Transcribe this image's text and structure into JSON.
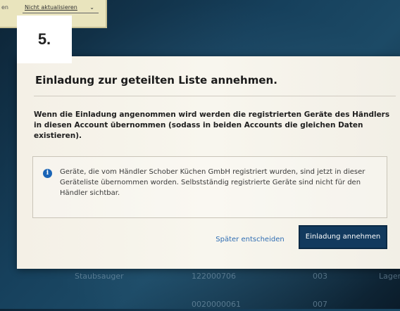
{
  "step_label": "5.",
  "toolbar": {
    "edge_text": "en",
    "dropdown_label": "Nicht aktualisieren",
    "dropdown_icon": "chevron-down-icon"
  },
  "dialog": {
    "title": "Einladung zur geteilten Liste annehmen.",
    "body": "Wenn die Einladung angenommen wird werden die registrierten Geräte des Händlers in diesen Account übernommen (sodass in beiden Accounts die gleichen Daten existieren).",
    "info_icon": "info-icon",
    "info_text": "Geräte, die vom Händler Schober Küchen GmbH registriert wurden, sind jetzt in dieser Geräteliste übernommen worden. Selbstständig registrierte Geräte sind nicht für den Händler sichtbar.",
    "secondary_button": "Später entscheiden",
    "primary_button": "Einladung annehmen"
  },
  "background_table": {
    "rows": [
      [
        "Staubsauger",
        "122000706",
        "003",
        "Lager"
      ],
      [
        "",
        "0020000061",
        "007",
        ""
      ]
    ]
  },
  "colors": {
    "primary_button_bg": "#123a5e",
    "link_color": "#2f6db3",
    "info_icon_color": "#1a64b6"
  }
}
